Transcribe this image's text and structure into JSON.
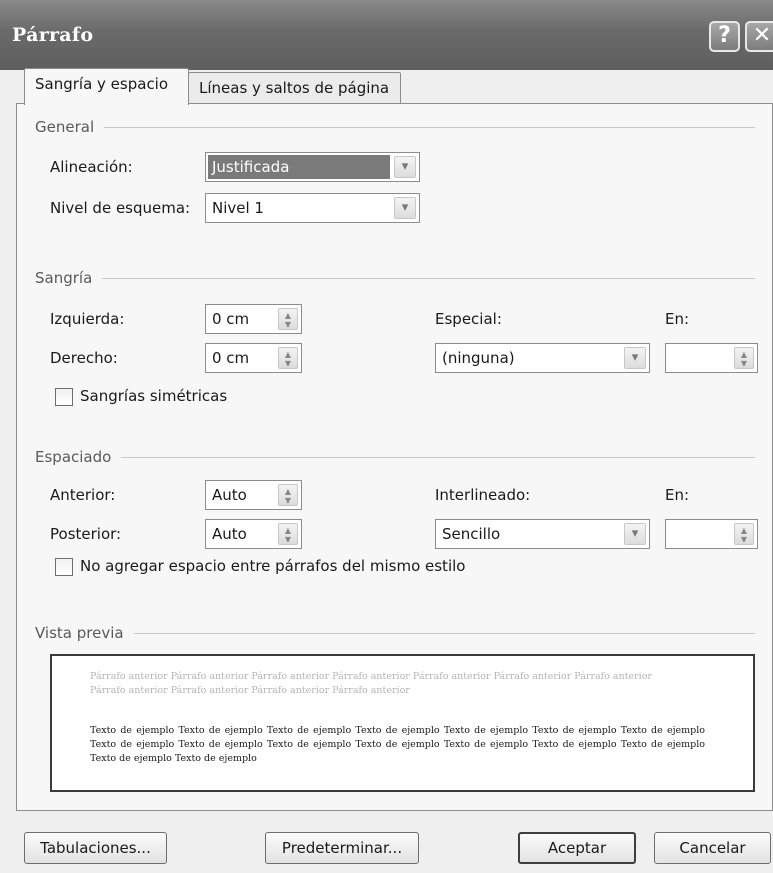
{
  "window": {
    "title": "Párrafo",
    "help_glyph": "?",
    "close_glyph": "✕"
  },
  "tabs": [
    {
      "label": "Sangría y espacio",
      "active": true
    },
    {
      "label": "Líneas y saltos de página",
      "active": false
    }
  ],
  "general": {
    "heading": "General",
    "alineacion_label": "Alineación:",
    "alineacion_value": "Justificada",
    "nivel_label": "Nivel de esquema:",
    "nivel_value": "Nivel 1"
  },
  "sangria": {
    "heading": "Sangría",
    "izquierda_label": "Izquierda:",
    "izquierda_value": "0 cm",
    "derecho_label": "Derecho:",
    "derecho_value": "0 cm",
    "especial_label": "Especial:",
    "especial_value": "(ninguna)",
    "en_label": "En:",
    "en_value": "",
    "simetricas_label": "Sangrías simétricas",
    "simetricas_checked": false
  },
  "espaciado": {
    "heading": "Espaciado",
    "anterior_label": "Anterior:",
    "anterior_value": "Auto",
    "posterior_label": "Posterior:",
    "posterior_value": "Auto",
    "interlineado_label": "Interlineado:",
    "interlineado_value": "Sencillo",
    "en_label": "En:",
    "en_value": "",
    "no_agregar_label": "No agregar espacio entre párrafos del mismo estilo",
    "no_agregar_checked": false
  },
  "vista_previa": {
    "heading": "Vista previa",
    "prior_text": "Párrafo anterior Párrafo anterior Párrafo anterior Párrafo anterior Párrafo anterior Párrafo anterior Párrafo anterior Párrafo anterior Párrafo anterior Párrafo anterior Párrafo anterior",
    "sample_text": "Texto de ejemplo Texto de ejemplo Texto de ejemplo Texto de ejemplo Texto de ejemplo Texto de ejemplo Texto de ejemplo Texto de ejemplo Texto de ejemplo Texto de ejemplo Texto de ejemplo Texto de ejemplo Texto de ejemplo Texto de ejemplo Texto de ejemplo Texto de ejemplo"
  },
  "buttons": {
    "tabulaciones": "Tabulaciones...",
    "predeterminar": "Predeterminar...",
    "aceptar": "Aceptar",
    "cancelar": "Cancelar"
  },
  "icons": {
    "dropdown": "▾",
    "spin_up": "▲",
    "spin_down": "▼"
  }
}
